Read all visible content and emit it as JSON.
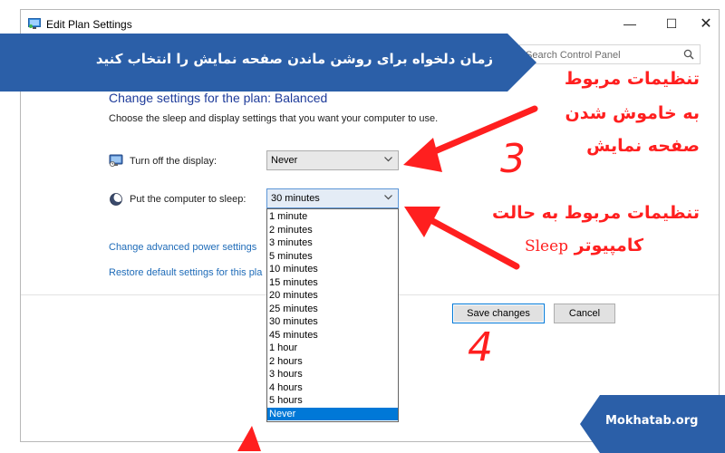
{
  "window": {
    "title": "Edit Plan Settings",
    "minimize_glyph": "—",
    "maximize_glyph": "☐",
    "close_glyph": "✕"
  },
  "search": {
    "placeholder": "Search Control Panel",
    "icon": "search-icon"
  },
  "content": {
    "heading": "Change settings for the plan: Balanced",
    "subtext": "Choose the sleep and display settings that you want your computer to use.",
    "display": {
      "label": "Turn off the display:",
      "value": "Never",
      "icon": "monitor-icon"
    },
    "sleep": {
      "label": "Put the computer to sleep:",
      "value": "30 minutes",
      "icon": "moon-icon"
    },
    "links": {
      "advanced": "Change advanced power settings",
      "restore": "Restore default settings for this pla"
    }
  },
  "buttons": {
    "save": "Save changes",
    "cancel": "Cancel"
  },
  "dropdown": {
    "options": [
      "1 minute",
      "2 minutes",
      "3 minutes",
      "5 minutes",
      "10 minutes",
      "15 minutes",
      "20 minutes",
      "25 minutes",
      "30 minutes",
      "45 minutes",
      "1 hour",
      "2 hours",
      "3 hours",
      "4 hours",
      "5 hours",
      "Never"
    ],
    "highlighted": "Never"
  },
  "overlay": {
    "banner_top": "زمان دلخواه برای روشن ماندن صفحه نمایش را انتخاب کنید",
    "banner_bottom": "Mokhatab.org",
    "annotation_display_line1": "تنظیمات مربوط",
    "annotation_display_line2": "به خاموش شدن",
    "annotation_display_line3": "صفحه نمایش",
    "annotation_sleep_line1": "تنظیمات مربوط به حالت",
    "annotation_sleep_line2_fa": "کامپیوتر",
    "annotation_sleep_line2_en": "Sleep",
    "step_three": "3",
    "step_four": "4"
  },
  "colors": {
    "banner": "#2b5fa8",
    "annotation": "#ff1f1f",
    "link": "#1e6bb8",
    "heading": "#1e3b9a",
    "selection": "#0078d7"
  }
}
